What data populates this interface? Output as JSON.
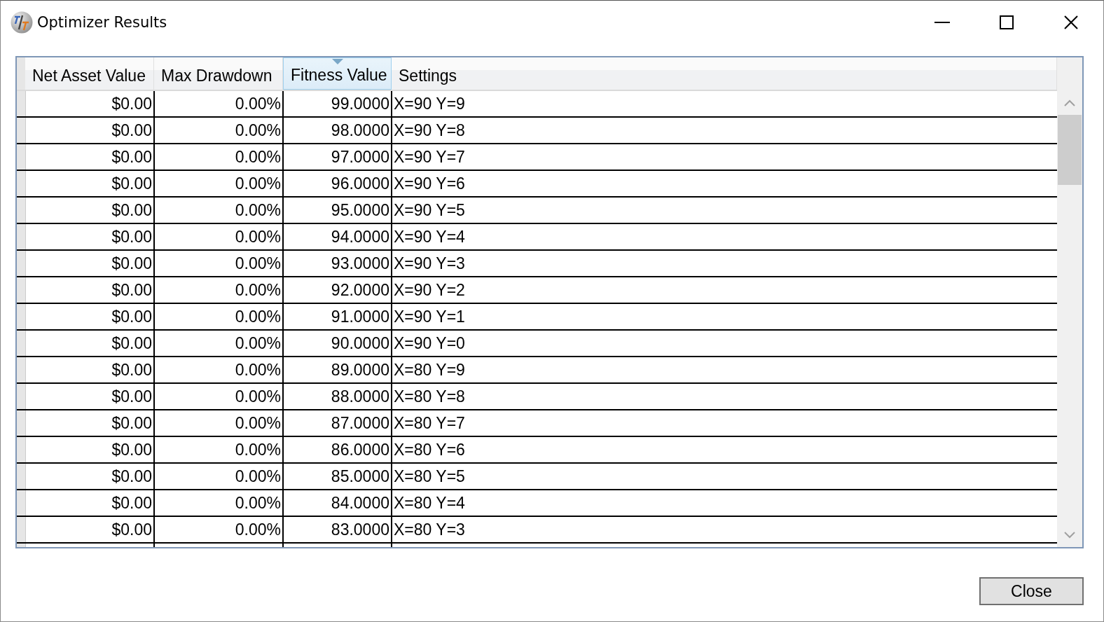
{
  "window": {
    "title": "Optimizer Results"
  },
  "table": {
    "columns": [
      {
        "label": "Net Asset Value",
        "sorted": false
      },
      {
        "label": "Max Drawdown",
        "sorted": false
      },
      {
        "label": "Fitness Value",
        "sorted": true
      },
      {
        "label": "Settings",
        "sorted": false
      }
    ],
    "rows": [
      [
        "$0.00",
        "0.00%",
        "99.0000",
        "X=90 Y=9"
      ],
      [
        "$0.00",
        "0.00%",
        "98.0000",
        "X=90 Y=8"
      ],
      [
        "$0.00",
        "0.00%",
        "97.0000",
        "X=90 Y=7"
      ],
      [
        "$0.00",
        "0.00%",
        "96.0000",
        "X=90 Y=6"
      ],
      [
        "$0.00",
        "0.00%",
        "95.0000",
        "X=90 Y=5"
      ],
      [
        "$0.00",
        "0.00%",
        "94.0000",
        "X=90 Y=4"
      ],
      [
        "$0.00",
        "0.00%",
        "93.0000",
        "X=90 Y=3"
      ],
      [
        "$0.00",
        "0.00%",
        "92.0000",
        "X=90 Y=2"
      ],
      [
        "$0.00",
        "0.00%",
        "91.0000",
        "X=90 Y=1"
      ],
      [
        "$0.00",
        "0.00%",
        "90.0000",
        "X=90 Y=0"
      ],
      [
        "$0.00",
        "0.00%",
        "89.0000",
        "X=80 Y=9"
      ],
      [
        "$0.00",
        "0.00%",
        "88.0000",
        "X=80 Y=8"
      ],
      [
        "$0.00",
        "0.00%",
        "87.0000",
        "X=80 Y=7"
      ],
      [
        "$0.00",
        "0.00%",
        "86.0000",
        "X=80 Y=6"
      ],
      [
        "$0.00",
        "0.00%",
        "85.0000",
        "X=80 Y=5"
      ],
      [
        "$0.00",
        "0.00%",
        "84.0000",
        "X=80 Y=4"
      ],
      [
        "$0.00",
        "0.00%",
        "83.0000",
        "X=80 Y=3"
      ]
    ]
  },
  "buttons": [
    {
      "label": "Close"
    }
  ]
}
